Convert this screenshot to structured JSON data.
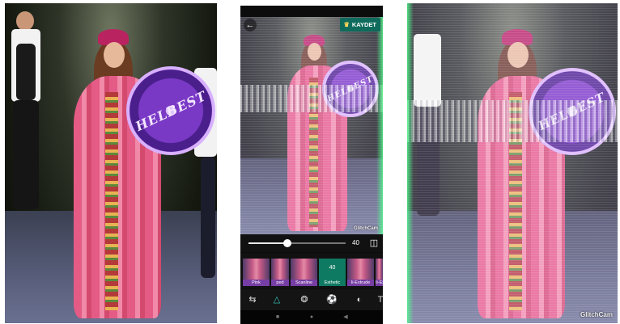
{
  "phone": {
    "save_label": "KAYDET",
    "slider_value": "40",
    "slider_fraction": 0.4,
    "watermark": "GlitchCam",
    "effects": [
      {
        "label": "Pink"
      },
      {
        "label": "ped"
      },
      {
        "label": "Scanline"
      },
      {
        "label": "Esthetic",
        "value": "40"
      },
      {
        "label": "Ii-Extrude"
      },
      {
        "label": "Ii-Extrude"
      },
      {
        "label": ""
      }
    ],
    "tools": [
      {
        "icon": "adjust-icon"
      },
      {
        "icon": "triangle-effects-icon"
      },
      {
        "icon": "color-mix-icon"
      },
      {
        "icon": "ball-icon"
      },
      {
        "icon": "overlay-icon"
      },
      {
        "icon": "text-icon"
      }
    ]
  },
  "right_photo": {
    "watermark": "GlitchCam"
  },
  "drum_text": "HELBEST",
  "colors": {
    "accent": "#0f6b5c",
    "active_tool": "#36c8c0"
  }
}
